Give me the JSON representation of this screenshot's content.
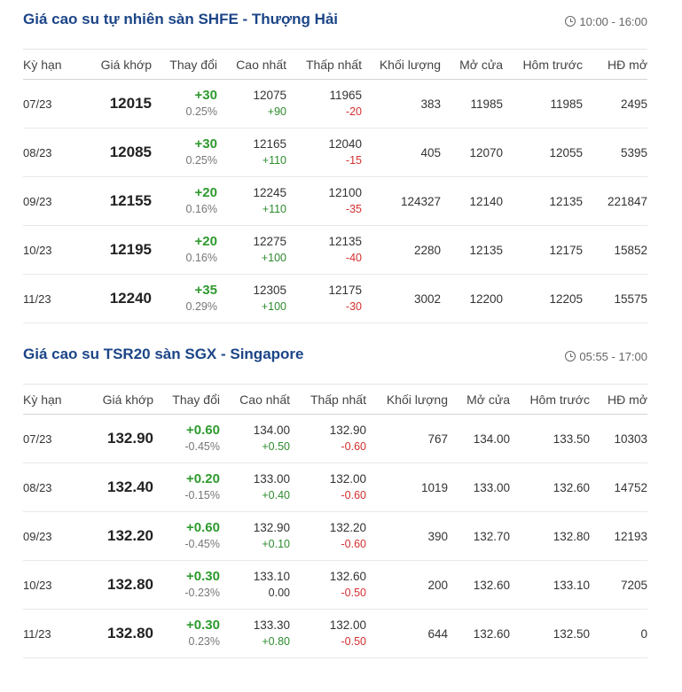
{
  "colors": {
    "title": "#1c4587",
    "up": "#2e9a2e",
    "down": "#d32f2f",
    "muted": "#777777"
  },
  "sections": [
    {
      "title": "Giá cao su tự nhiên sàn SHFE - Thượng Hải",
      "hours": "10:00 - 16:00",
      "icon": "clock-icon",
      "columns": [
        "Kỳ hạn",
        "Giá khớp",
        "Thay đổi",
        "Cao nhất",
        "Thấp nhất",
        "Khối lượng",
        "Mở cửa",
        "Hôm trước",
        "HĐ mở"
      ],
      "rows": [
        {
          "term": "07/23",
          "price": "12015",
          "change": "+30",
          "pct": "0.25%",
          "high": "12075",
          "high_chg": "+90",
          "high_dir": "up",
          "low": "11965",
          "low_chg": "-20",
          "low_dir": "down",
          "volume": "383",
          "open": "11985",
          "prev": "11985",
          "oi": "2495"
        },
        {
          "term": "08/23",
          "price": "12085",
          "change": "+30",
          "pct": "0.25%",
          "high": "12165",
          "high_chg": "+110",
          "high_dir": "up",
          "low": "12040",
          "low_chg": "-15",
          "low_dir": "down",
          "volume": "405",
          "open": "12070",
          "prev": "12055",
          "oi": "5395"
        },
        {
          "term": "09/23",
          "price": "12155",
          "change": "+20",
          "pct": "0.16%",
          "high": "12245",
          "high_chg": "+110",
          "high_dir": "up",
          "low": "12100",
          "low_chg": "-35",
          "low_dir": "down",
          "volume": "124327",
          "open": "12140",
          "prev": "12135",
          "oi": "221847"
        },
        {
          "term": "10/23",
          "price": "12195",
          "change": "+20",
          "pct": "0.16%",
          "high": "12275",
          "high_chg": "+100",
          "high_dir": "up",
          "low": "12135",
          "low_chg": "-40",
          "low_dir": "down",
          "volume": "2280",
          "open": "12135",
          "prev": "12175",
          "oi": "15852"
        },
        {
          "term": "11/23",
          "price": "12240",
          "change": "+35",
          "pct": "0.29%",
          "high": "12305",
          "high_chg": "+100",
          "high_dir": "up",
          "low": "12175",
          "low_chg": "-30",
          "low_dir": "down",
          "volume": "3002",
          "open": "12200",
          "prev": "12205",
          "oi": "15575"
        }
      ]
    },
    {
      "title": "Giá cao su TSR20 sàn SGX - Singapore",
      "hours": "05:55 - 17:00",
      "icon": "clock-icon",
      "columns": [
        "Kỳ hạn",
        "Giá khớp",
        "Thay đổi",
        "Cao nhất",
        "Thấp nhất",
        "Khối lượng",
        "Mở cửa",
        "Hôm trước",
        "HĐ mở"
      ],
      "rows": [
        {
          "term": "07/23",
          "price": "132.90",
          "change": "+0.60",
          "pct": "-0.45%",
          "high": "134.00",
          "high_chg": "+0.50",
          "high_dir": "up",
          "low": "132.90",
          "low_chg": "-0.60",
          "low_dir": "down",
          "volume": "767",
          "open": "134.00",
          "prev": "133.50",
          "oi": "10303"
        },
        {
          "term": "08/23",
          "price": "132.40",
          "change": "+0.20",
          "pct": "-0.15%",
          "high": "133.00",
          "high_chg": "+0.40",
          "high_dir": "up",
          "low": "132.00",
          "low_chg": "-0.60",
          "low_dir": "down",
          "volume": "1019",
          "open": "133.00",
          "prev": "132.60",
          "oi": "14752"
        },
        {
          "term": "09/23",
          "price": "132.20",
          "change": "+0.60",
          "pct": "-0.45%",
          "high": "132.90",
          "high_chg": "+0.10",
          "high_dir": "up",
          "low": "132.20",
          "low_chg": "-0.60",
          "low_dir": "down",
          "volume": "390",
          "open": "132.70",
          "prev": "132.80",
          "oi": "12193"
        },
        {
          "term": "10/23",
          "price": "132.80",
          "change": "+0.30",
          "pct": "-0.23%",
          "high": "133.10",
          "high_chg": "0.00",
          "high_dir": "flat",
          "low": "132.60",
          "low_chg": "-0.50",
          "low_dir": "down",
          "volume": "200",
          "open": "132.60",
          "prev": "133.10",
          "oi": "7205"
        },
        {
          "term": "11/23",
          "price": "132.80",
          "change": "+0.30",
          "pct": "0.23%",
          "high": "133.30",
          "high_chg": "+0.80",
          "high_dir": "up",
          "low": "132.00",
          "low_chg": "-0.50",
          "low_dir": "down",
          "volume": "644",
          "open": "132.60",
          "prev": "132.50",
          "oi": "0"
        }
      ]
    }
  ]
}
